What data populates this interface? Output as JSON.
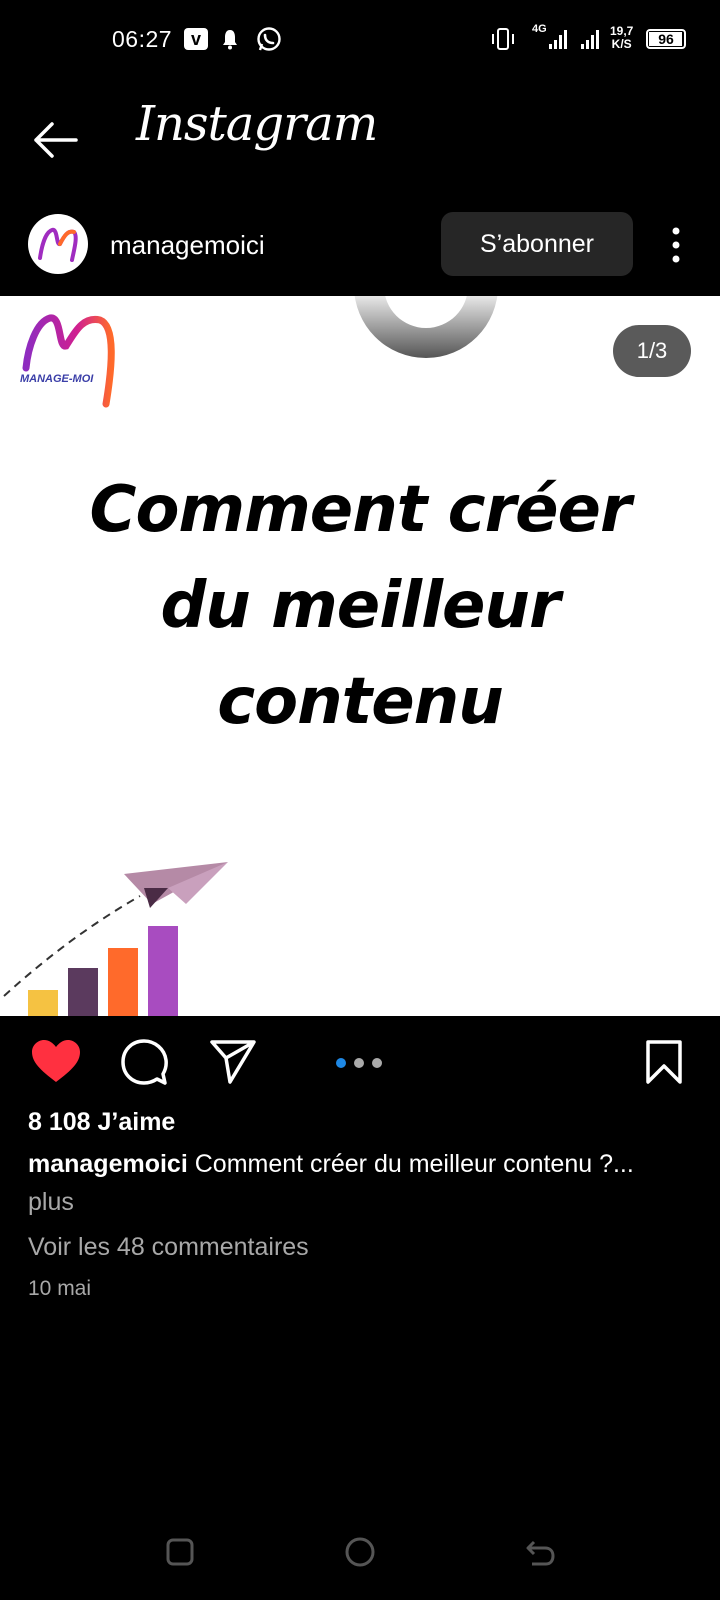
{
  "status_bar": {
    "time": "06:27",
    "network": "4G",
    "speed_value": "19,7",
    "speed_unit": "K/S",
    "battery": "96",
    "battery_level": 0.96,
    "icons": [
      "v-app-icon",
      "bell-icon",
      "whatsapp-icon",
      "vibrate-icon",
      "signal-icon",
      "battery-icon"
    ]
  },
  "header": {
    "title": "Instagram",
    "back_icon": "arrow-left-icon"
  },
  "post": {
    "username": "managemoici",
    "follow_label": "S’abonner",
    "slide_counter": "1/3",
    "headline_lines": [
      "Comment créer",
      "du meilleur",
      "contenu"
    ],
    "logo_text": "MANAGE-MOI",
    "likes": "8 108 J’aime",
    "caption_user": "managemoici",
    "caption_text": "Comment créer du meilleur contenu ?...",
    "more_label": "plus",
    "comments_label": "Voir les 48 commentaires",
    "date": "10 mai",
    "carousel": {
      "count": 3,
      "active": 1
    },
    "liked": true
  },
  "colors": {
    "background": "#000000",
    "like_red": "#ff3040",
    "follow_button": "#262626",
    "carousel_active": "#1e88e5",
    "secondary_text": "#a8a8a8",
    "chart_bar_colors": [
      "#f5c242",
      "#5b3a5e",
      "#ff6a2b",
      "#a84cc0"
    ]
  }
}
